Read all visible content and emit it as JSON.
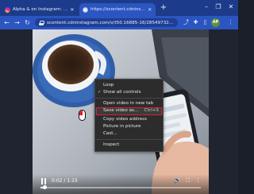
{
  "tabs": [
    {
      "title": "Alpha & on Instagram: \"How to i",
      "active": false,
      "icon": "instagram-icon"
    },
    {
      "title": "https://scontent.cdninstagram.",
      "active": true,
      "icon": "globe-icon"
    }
  ],
  "new_tab": "+",
  "window_controls": {
    "minimize": "–",
    "maximize": "❐",
    "close": "✕"
  },
  "toolbar": {
    "back": "←",
    "forward": "→",
    "reload": "↻",
    "url": "scontent.cdninstagram.com/v/t50.16885-16/28549732...",
    "avatar": "AP"
  },
  "context_menu": {
    "items": [
      {
        "label": "Loop",
        "checked": false,
        "shortcut": ""
      },
      {
        "label": "Show all controls",
        "checked": true,
        "shortcut": ""
      },
      {
        "label": "Open video in new tab",
        "checked": false,
        "shortcut": ""
      },
      {
        "label": "Save video as...",
        "checked": false,
        "shortcut": "Ctrl+S",
        "highlighted": true
      },
      {
        "label": "Copy video address",
        "checked": false,
        "shortcut": ""
      },
      {
        "label": "Picture in picture",
        "checked": false,
        "shortcut": ""
      },
      {
        "label": "Cast...",
        "checked": false,
        "shortcut": ""
      },
      {
        "label": "Inspect",
        "checked": false,
        "shortcut": ""
      }
    ],
    "check_mark": "✓"
  },
  "video": {
    "time": "0:02 / 1:15",
    "progress": 0.027
  },
  "colors": {
    "tabstrip": "#1c3b8a",
    "toolbar": "#2b55c0",
    "menu_bg": "#2c2c2c",
    "highlight_border": "#d3222a"
  }
}
